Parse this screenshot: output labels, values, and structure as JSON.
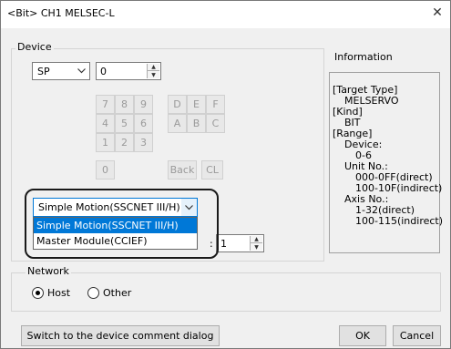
{
  "window": {
    "title": "<Bit> CH1 MELSEC-L"
  },
  "device": {
    "legend": "Device",
    "type_value": "SP",
    "number_value": "0",
    "keypad": {
      "row1": [
        "7",
        "8",
        "9",
        "D",
        "E",
        "F"
      ],
      "row2": [
        "4",
        "5",
        "6",
        "A",
        "B",
        "C"
      ],
      "row3": [
        "1",
        "2",
        "3"
      ],
      "row4": [
        "0",
        "Back",
        "CL"
      ]
    },
    "module_select": {
      "value": "Simple Motion(SSCNET III/H)",
      "options": [
        "Simple Motion(SSCNET III/H)",
        "Master Module(CCIEF)"
      ]
    },
    "axis_label_fragment": ":",
    "axis_value": "1"
  },
  "information": {
    "legend": "Information",
    "lines": [
      "[Target Type]",
      "MELSERVO",
      "[Kind]",
      "BIT",
      "[Range]",
      "Device:",
      "0-6",
      "Unit No.:",
      "000-0FF(direct)",
      "100-10F(indirect)",
      "Axis No.:",
      "1-32(direct)",
      "100-115(indirect)"
    ]
  },
  "network": {
    "legend": "Network",
    "host_label": "Host",
    "other_label": "Other",
    "selected": "Host"
  },
  "buttons": {
    "switch": "Switch to the device comment dialog",
    "ok": "OK",
    "cancel": "Cancel"
  }
}
